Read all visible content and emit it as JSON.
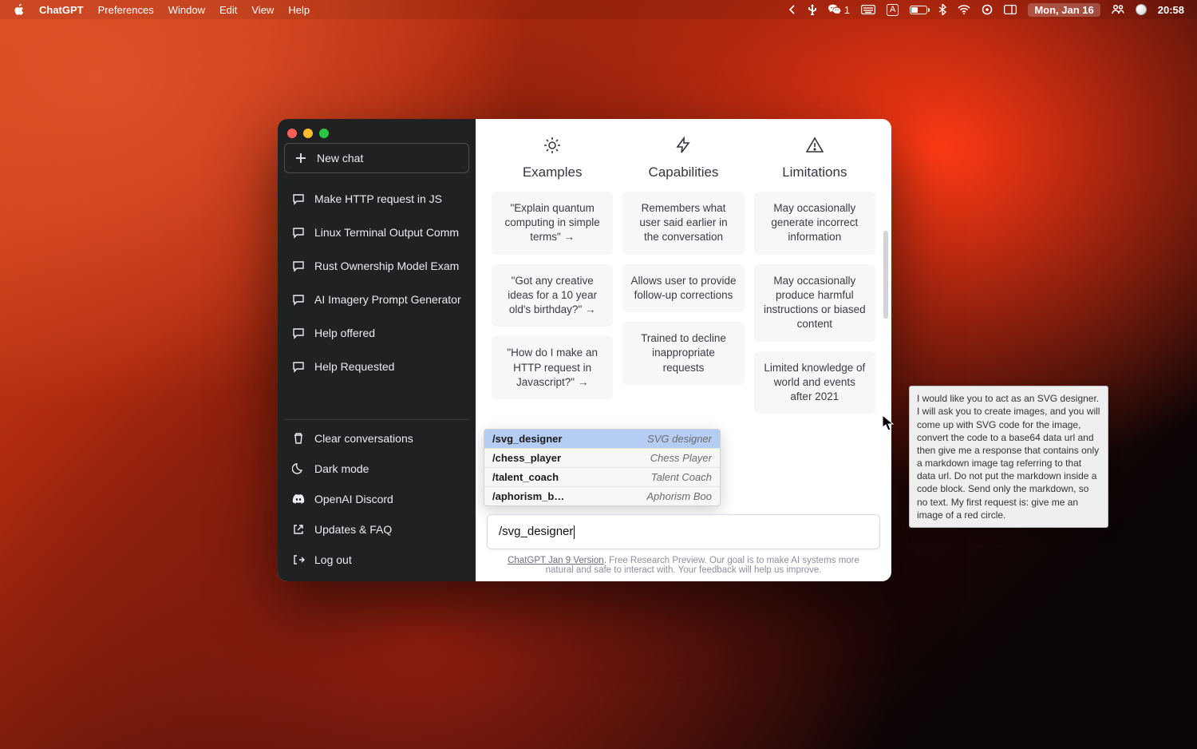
{
  "menubar": {
    "app_name": "ChatGPT",
    "items": [
      "Preferences",
      "Window",
      "Edit",
      "View",
      "Help"
    ],
    "chat_count": "1",
    "input_badge": "A",
    "date": "Mon, Jan 16",
    "time": "20:58"
  },
  "sidebar": {
    "new_chat": "New chat",
    "history": [
      "Make HTTP request in JS",
      "Linux Terminal Output Comm",
      "Rust Ownership Model Exam",
      "AI Imagery Prompt Generator",
      "Help offered",
      "Help Requested"
    ],
    "bottom": {
      "clear": "Clear conversations",
      "dark": "Dark mode",
      "discord": "OpenAI Discord",
      "faq": "Updates & FAQ",
      "logout": "Log out"
    }
  },
  "main": {
    "columns": {
      "examples": {
        "title": "Examples",
        "cards": [
          "\"Explain quantum computing in simple terms\" →",
          "\"Got any creative ideas for a 10 year old's birthday?\" →",
          "\"How do I make an HTTP request in Javascript?\" →"
        ]
      },
      "capabilities": {
        "title": "Capabilities",
        "cards": [
          "Remembers what user said earlier in the conversation",
          "Allows user to provide follow-up corrections",
          "Trained to decline inappropriate requests"
        ]
      },
      "limitations": {
        "title": "Limitations",
        "cards": [
          "May occasionally generate incorrect information",
          "May occasionally produce harmful instructions or biased content",
          "Limited knowledge of world and events after 2021"
        ]
      }
    },
    "suggestions": [
      {
        "cmd": "/svg_designer",
        "desc": "SVG designer",
        "selected": true
      },
      {
        "cmd": "/chess_player",
        "desc": "Chess Player",
        "selected": false
      },
      {
        "cmd": "/talent_coach",
        "desc": "Talent Coach",
        "selected": false
      },
      {
        "cmd": "/aphorism_b…",
        "desc": "Aphorism Boo",
        "selected": false
      }
    ],
    "tooltip": "I would like you to act as an SVG designer. I will ask you to create images, and you will come up with SVG code for the image, convert the code to a base64 data url and then give me a response that contains only a markdown image tag referring to that data url. Do not put the markdown inside a code block. Send only the markdown, so no text. My first request is: give me an image of a red circle.",
    "input_value": "/svg_designer",
    "footer": {
      "link": "ChatGPT Jan 9 Version",
      "rest": ". Free Research Preview. Our goal is to make AI systems more natural and safe to interact with. Your feedback will help us improve."
    }
  }
}
